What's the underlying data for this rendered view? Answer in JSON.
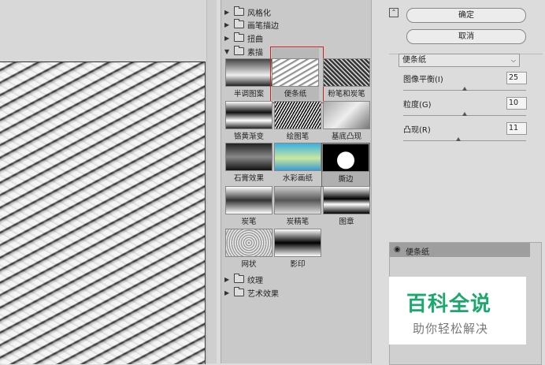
{
  "gallery": {
    "folders_top": [
      {
        "label": "风格化",
        "expanded": false
      },
      {
        "label": "画笔描边",
        "expanded": false
      },
      {
        "label": "扭曲",
        "expanded": false
      },
      {
        "label": "素描",
        "expanded": true
      }
    ],
    "thumbnails": [
      {
        "label": "半调图案"
      },
      {
        "label": "便条纸",
        "selected": true
      },
      {
        "label": "粉笔和炭笔"
      },
      {
        "label": "铬黄渐变"
      },
      {
        "label": "绘图笔"
      },
      {
        "label": "基底凸现"
      },
      {
        "label": "石膏效果"
      },
      {
        "label": "水彩画纸"
      },
      {
        "label": "撕边"
      },
      {
        "label": "炭笔"
      },
      {
        "label": "炭精笔"
      },
      {
        "label": "图章"
      },
      {
        "label": "网状"
      },
      {
        "label": "影印"
      }
    ],
    "folders_bottom": [
      {
        "label": "纹理",
        "expanded": false
      },
      {
        "label": "艺术效果",
        "expanded": false
      }
    ]
  },
  "controls": {
    "ok_label": "确定",
    "cancel_label": "取消",
    "filter_select": "便条纸",
    "params": [
      {
        "label": "图像平衡(I)",
        "value": "25",
        "fraction": 0.5
      },
      {
        "label": "粒度(G)",
        "value": "10",
        "fraction": 0.5
      },
      {
        "label": "凸现(R)",
        "value": "11",
        "fraction": 0.45
      }
    ]
  },
  "layers": {
    "active_layer": "便条纸"
  },
  "watermark": {
    "title": "百科全说",
    "subtitle": "助你轻松解决"
  },
  "colors": {
    "selection": "#d02020",
    "watermark_green": "#1aa86c"
  }
}
